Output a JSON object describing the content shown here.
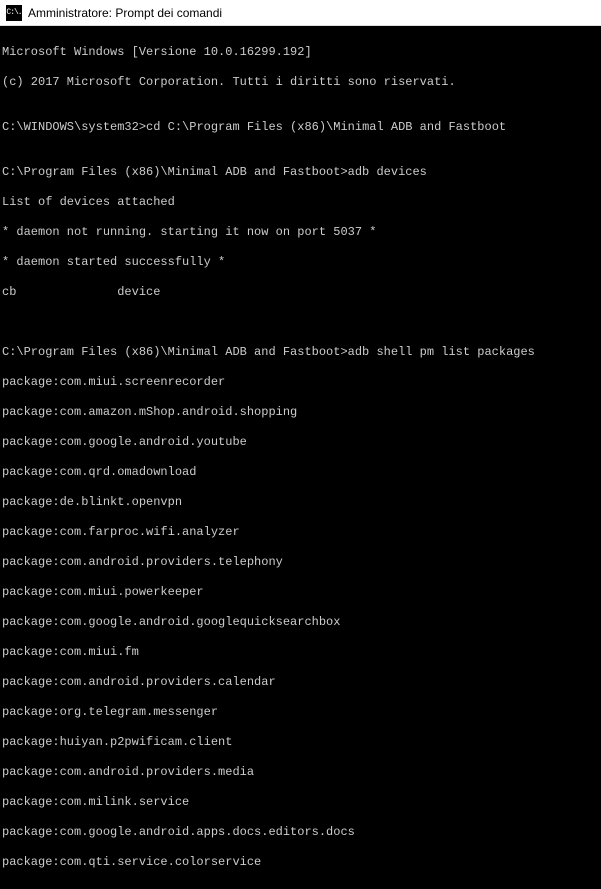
{
  "titlebar": {
    "icon_text": "C:\\.",
    "title": "Amministratore: Prompt dei comandi"
  },
  "header_lines": [
    "Microsoft Windows [Versione 10.0.16299.192]",
    "(c) 2017 Microsoft Corporation. Tutti i diritti sono riservati.",
    ""
  ],
  "prompt1": {
    "prompt": "C:\\WINDOWS\\system32>",
    "command": "cd C:\\Program Files (x86)\\Minimal ADB and Fastboot"
  },
  "blank1": "",
  "prompt2": {
    "prompt": "C:\\Program Files (x86)\\Minimal ADB and Fastboot>",
    "command": "adb devices"
  },
  "adb_devices_output": [
    "List of devices attached",
    "* daemon not running. starting it now on port 5037 *",
    "* daemon started successfully *",
    "cb              device",
    "",
    ""
  ],
  "prompt3": {
    "prompt": "C:\\Program Files (x86)\\Minimal ADB and Fastboot>",
    "command": "adb shell pm list packages"
  },
  "packages": [
    "package:com.miui.screenrecorder",
    "package:com.amazon.mShop.android.shopping",
    "package:com.google.android.youtube",
    "package:com.qrd.omadownload",
    "package:de.blinkt.openvpn",
    "package:com.farproc.wifi.analyzer",
    "package:com.android.providers.telephony",
    "package:com.miui.powerkeeper",
    "package:com.google.android.googlequicksearchbox",
    "package:com.miui.fm",
    "package:com.android.providers.calendar",
    "package:org.telegram.messenger",
    "package:huiyan.p2pwificam.client",
    "package:com.android.providers.media",
    "package:com.milink.service",
    "package:com.google.android.apps.docs.editors.docs",
    "package:com.qti.service.colorservice"
  ]
}
